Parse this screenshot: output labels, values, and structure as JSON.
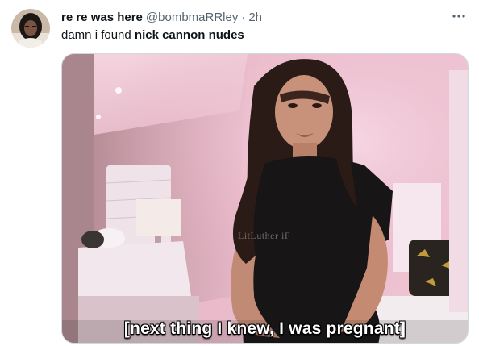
{
  "tweet": {
    "display_name": "re re was here",
    "handle": "@bombmaRRley",
    "separator": "·",
    "time": "2h",
    "text_prefix": "damn i found ",
    "text_bold": "nick cannon nudes",
    "more_icon": "more-horizontal-icon"
  },
  "media": {
    "caption": "[next thing I knew, I was pregnant]",
    "watermark": "LitLuther iF"
  },
  "colors": {
    "primary_text": "#0f1419",
    "secondary_text": "#536471",
    "border": "#cfd9de",
    "background": "#ffffff"
  }
}
